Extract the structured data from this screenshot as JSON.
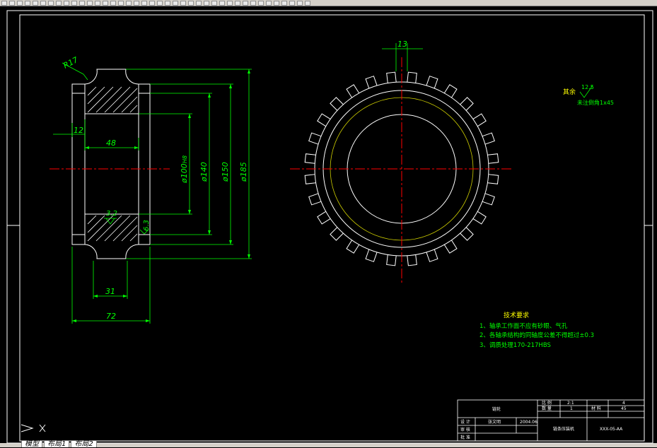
{
  "toolbar": {
    "button_count": 40
  },
  "layout_tabs": [
    "模型",
    "布局1",
    "布局2"
  ],
  "dimensions": {
    "radius": "R17",
    "d12": "12",
    "d48": "48",
    "d31": "31",
    "d72": "72",
    "d13": "13",
    "dia100": "ø100",
    "dia100_note": "H8",
    "dia140": "ø140",
    "dia150": "ø150",
    "dia185": "ø185",
    "rough32": "3.2",
    "rough63": "6.3"
  },
  "surface_note": {
    "label": "其余",
    "value": "12.5",
    "text": "未注倒角1x45"
  },
  "tech_requirements": {
    "title": "技术要求",
    "items": [
      "1、轴承工作面不应有砂眼、气孔",
      "2、各轴承结构的同轴度公差不得超过±0.3",
      "3、调质处理170-217HBS"
    ]
  },
  "title_block": {
    "cell_top_left": "链轮",
    "labels": [
      "比 例",
      "数 量",
      "材 料"
    ],
    "scale": "2:1",
    "quantity": "1",
    "sheet": "4",
    "material": "45",
    "design_label": "设 计",
    "designer": "张文明",
    "date": "2004.06",
    "check_label": "审 核",
    "approve_label": "批 准",
    "part_name": "链条压装机",
    "drawing_no": "XXX-05-AA"
  },
  "colors": {
    "background": "#000000",
    "outline": "#ffffff",
    "dimension": "#00ff00",
    "centerline": "#ff0000",
    "text": "#ffff00"
  }
}
